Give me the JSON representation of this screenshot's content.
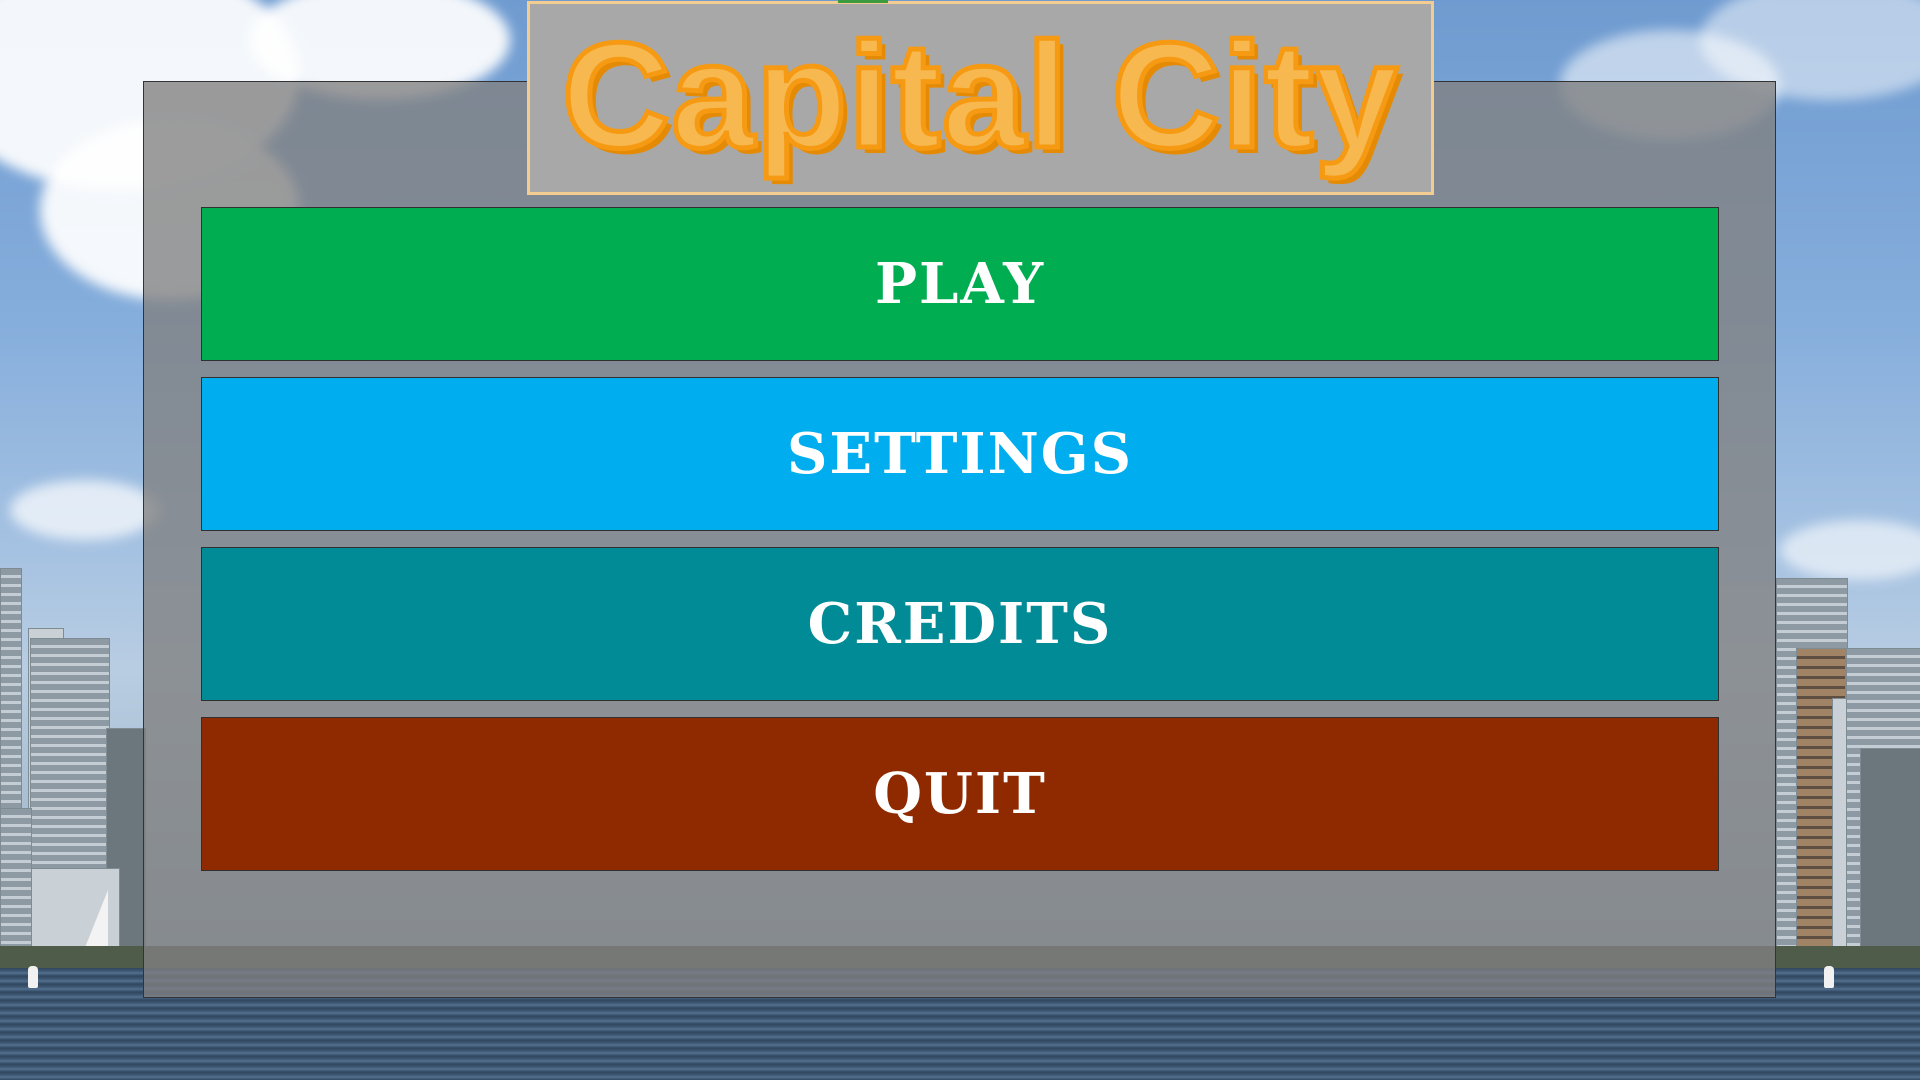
{
  "game": {
    "title": "Capital City"
  },
  "menu": {
    "buttons": [
      {
        "label": "PLAY",
        "color": "#00ad50"
      },
      {
        "label": "SETTINGS",
        "color": "#00adef"
      },
      {
        "label": "CREDITS",
        "color": "#008b96"
      },
      {
        "label": "QUIT",
        "color": "#8f2a00"
      }
    ]
  },
  "colors": {
    "title_fill": "#f6b84f",
    "title_outline": "#f59a12",
    "title_box_border": "#f3cd8f",
    "panel_overlay": "#808080"
  }
}
